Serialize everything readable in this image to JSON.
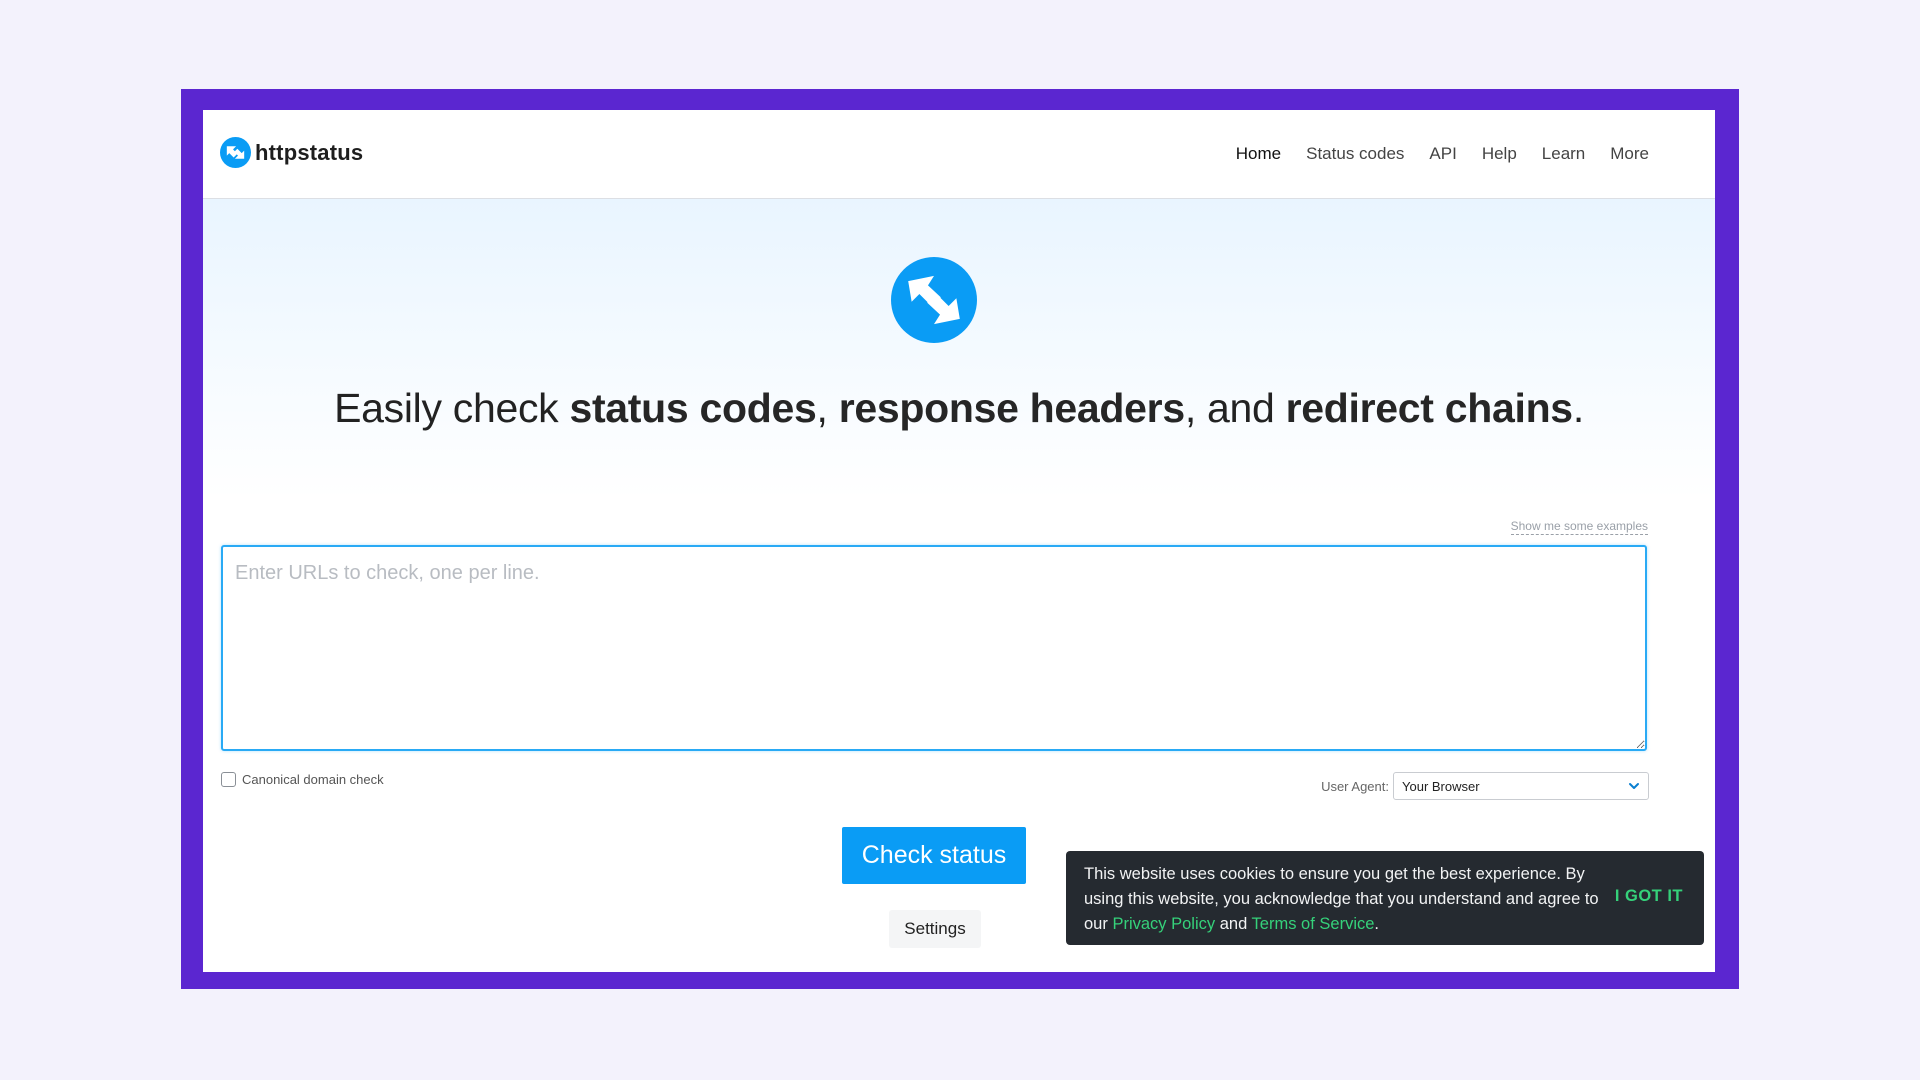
{
  "brand": {
    "name": "httpstatus"
  },
  "nav": {
    "items": [
      {
        "label": "Home",
        "active": true
      },
      {
        "label": "Status codes"
      },
      {
        "label": "API"
      },
      {
        "label": "Help"
      },
      {
        "label": "Learn"
      },
      {
        "label": "More"
      }
    ]
  },
  "hero": {
    "headline": {
      "prefix": "Easily check ",
      "bold1": "status codes",
      "sep1": ", ",
      "bold2": "response headers",
      "sep2": ", and ",
      "bold3": "redirect chains",
      "suffix": "."
    }
  },
  "form": {
    "examples_link": "Show me some examples",
    "urls_placeholder": "Enter URLs to check, one per line.",
    "urls_value": "",
    "canonical_label": "Canonical domain check",
    "canonical_checked": false,
    "user_agent_label": "User Agent:",
    "user_agent_value": "Your Browser",
    "check_button": "Check status",
    "settings_button": "Settings"
  },
  "cookie": {
    "line_prefix": "This website uses cookies to ensure you get the best experience. By using this website, you acknowledge that you understand and agree to our ",
    "privacy_link": "Privacy Policy",
    "and": " and ",
    "terms_link": "Terms of Service",
    "end": ".",
    "accept": "I GOT IT"
  },
  "colors": {
    "frame": "#5b26d0",
    "accent": "#0a9cf5",
    "cookie_bg": "#252a30",
    "cookie_link": "#35d17a"
  },
  "icons": {
    "brand_logo": "arrows-in-out-icon",
    "ua_chevron": "chevron-down-icon"
  }
}
